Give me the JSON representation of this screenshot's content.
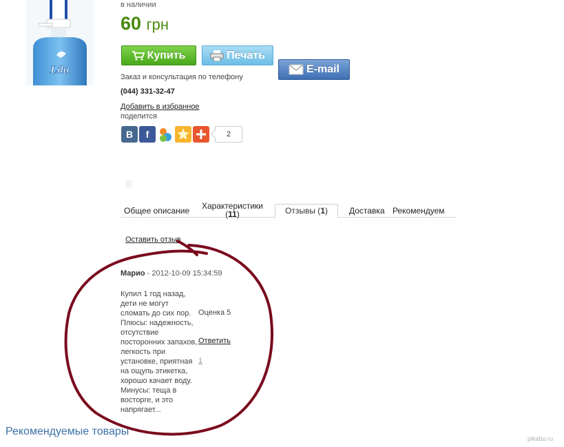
{
  "product": {
    "availability": "в наличии",
    "price_value": "60",
    "price_currency": "грн"
  },
  "actions": {
    "buy_label": "Купить",
    "print_label": "Печать",
    "email_label": "E-mail"
  },
  "contact": {
    "consult_text": "Заказ и консультация по телефону",
    "phone": "(044) 331-32-47"
  },
  "favorites_link": "Добавить в избранное",
  "share": {
    "label": "поделится",
    "vk_letter": "B",
    "fb_letter": "f",
    "count": "2"
  },
  "tabs": {
    "overview": "Общее описание",
    "specs": "Характеристики",
    "specs_count": "11",
    "reviews": "Отзывы",
    "reviews_count": "1",
    "delivery": "Доставка",
    "recommend": "Рекомендуем"
  },
  "review_form_link": "Оставить отзыв",
  "review": {
    "author": "Марио",
    "date": "2012-10-09 15:34:59",
    "text": "Купил 1 год назад, дети не могут сломать до сих пор. Плюсы: надежность, отсутствие посторонних запахов, легкость при установке, приятная на ощупь этикетка, хорошо качает воду. Минусы: теща в восторге, и это напрягает...",
    "rating": "Оценка 5",
    "reply_label": "Ответить",
    "vote_count": "1"
  },
  "recommended_title": "Рекомендуемые товары",
  "image_logo_text": "Lilu",
  "watermark": "pikabu.ru",
  "colors": {
    "price_green": "#4a8a10",
    "buy_green": "#5bbd26",
    "print_blue": "#6cbde6",
    "email_blue": "#3f6fb3",
    "annotation_red": "#7a0a1e",
    "recommended_blue": "#3d6fa8"
  }
}
